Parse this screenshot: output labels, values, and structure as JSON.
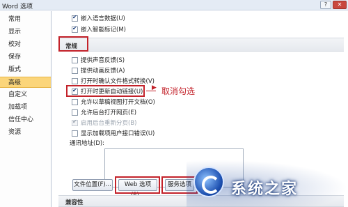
{
  "window": {
    "title": "Word 选项"
  },
  "sidebar": {
    "items": [
      {
        "label": "常用"
      },
      {
        "label": "显示"
      },
      {
        "label": "校对"
      },
      {
        "label": "保存"
      },
      {
        "label": "版式"
      },
      {
        "label": "高级",
        "active": true
      },
      {
        "label": "自定义"
      },
      {
        "label": "加载项"
      },
      {
        "label": "信任中心"
      },
      {
        "label": "资源"
      }
    ]
  },
  "top_options": [
    {
      "label": "嵌入语言数据(U)",
      "checked": true
    },
    {
      "label": "嵌入智能标记(M)",
      "checked": true
    }
  ],
  "section_general": {
    "title": "常规"
  },
  "general_options": [
    {
      "label": "提供声音反馈(S)",
      "checked": false
    },
    {
      "label": "提供动画反馈(A)",
      "checked": false
    },
    {
      "label": "打开时确认文件格式转换(V)",
      "checked": false
    },
    {
      "label": "打开时更新自动链接(U)",
      "checked": true
    },
    {
      "label": "允许以草稿视图打开文档(O)",
      "checked": false
    },
    {
      "label": "允许后台打开网页(E)",
      "checked": false
    },
    {
      "label": "启用后台重新分页(B)",
      "checked": true,
      "disabled": true
    },
    {
      "label": "显示加载项用户接口错误(U)",
      "checked": false
    }
  ],
  "annotation": {
    "text": "取消勾选"
  },
  "mail_address": {
    "label": "通讯地址(D):"
  },
  "buttons": {
    "file_locations": "文件位置(F)...",
    "web_options": "Web 选项(P)...",
    "service_options": "服务选项"
  },
  "section_compat": {
    "title": "兼容性"
  },
  "watermark": {
    "text": "系统之家"
  },
  "colors": {
    "accent_red": "#c3222a",
    "active_item": "#fbd57a"
  }
}
